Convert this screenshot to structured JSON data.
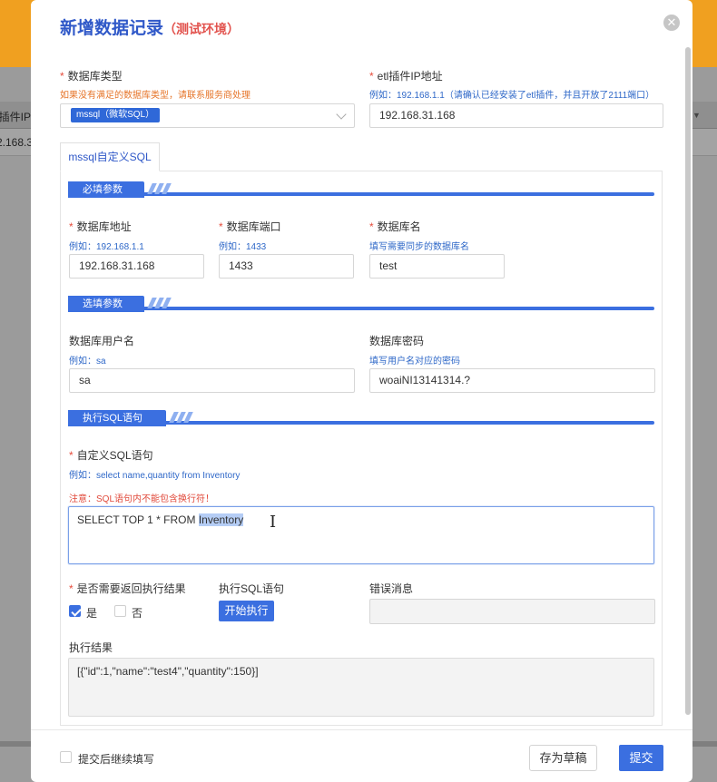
{
  "background": {
    "table_header_text": "l插件IP",
    "table_row_text": "2.168.3"
  },
  "modal": {
    "title": "新增数据记录",
    "title_sub": "（测试环境）",
    "close_icon": "close-icon"
  },
  "db_type": {
    "required": "*",
    "label": "数据库类型",
    "hint": "如果没有满足的数据库类型，请联系服务商处理",
    "selected_tag": "mssql（微软SQL）"
  },
  "etl_ip": {
    "required": "*",
    "label": "etl插件IP地址",
    "hint": "例如：192.168.1.1（请确认已经安装了etl插件，并且开放了2111端口）",
    "value": "192.168.31.168"
  },
  "tab": {
    "label": "mssql自定义SQL"
  },
  "sections": {
    "required": "必填参数",
    "optional": "选填参数",
    "execute": "执行SQL语句"
  },
  "db_address": {
    "required": "*",
    "label": "数据库地址",
    "hint": "例如：192.168.1.1",
    "value": "192.168.31.168"
  },
  "db_port": {
    "required": "*",
    "label": "数据库端口",
    "hint": "例如：1433",
    "value": "1433"
  },
  "db_name": {
    "required": "*",
    "label": "数据库名",
    "hint": "填写需要同步的数据库名",
    "value": "test"
  },
  "db_user": {
    "label": "数据库用户名",
    "hint": "例如：sa",
    "value": "sa"
  },
  "db_password": {
    "label": "数据库密码",
    "hint": "填写用户名对应的密码",
    "value": "woaiNI13141314.?"
  },
  "custom_sql": {
    "required": "*",
    "label": "自定义SQL语句",
    "hint": "例如：select name,quantity from Inventory",
    "warning": "注意：SQL语句内不能包含换行符！",
    "value_prefix": "SELECT TOP 1 * FROM ",
    "value_selected": "Inventory"
  },
  "return_result": {
    "required": "*",
    "label": "是否需要返回执行结果",
    "yes": "是",
    "no": "否",
    "yes_checked": true
  },
  "execute_sql": {
    "label": "执行SQL语句",
    "button": "开始执行"
  },
  "error_msg": {
    "label": "错误消息",
    "value": ""
  },
  "exec_result": {
    "label": "执行结果",
    "value": "[{\"id\":1,\"name\":\"test4\",\"quantity\":150}]"
  },
  "footer": {
    "continue_label": "提交后继续填写",
    "draft_button": "存为草稿",
    "submit_button": "提交"
  },
  "colors": {
    "primary": "#3b6fe0",
    "title": "#2f58c8",
    "danger": "#e74c3c",
    "warning_orange": "#e6752a"
  }
}
